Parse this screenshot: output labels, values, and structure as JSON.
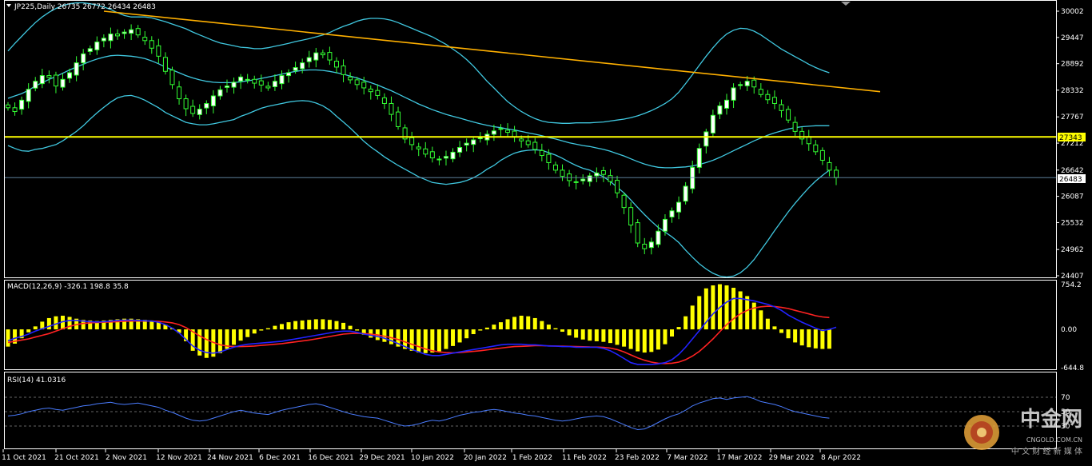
{
  "chart_data": [
    {
      "type": "candlestick",
      "title": "JP225,Daily 26735 26772 26434 26483",
      "x_labels": [
        "11 Oct 2021",
        "21 Oct 2021",
        "2 Nov 2021",
        "12 Nov 2021",
        "24 Nov 2021",
        "6 Dec 2021",
        "16 Dec 2021",
        "29 Dec 2021",
        "10 Jan 2022",
        "20 Jan 2022",
        "1 Feb 2022",
        "11 Feb 2022",
        "23 Feb 2022",
        "7 Mar 2022",
        "17 Mar 2022",
        "29 Mar 2022",
        "8 Apr 2022"
      ],
      "y_ticks": [
        "30002",
        "29447",
        "28892",
        "28332",
        "27767",
        "27212",
        "26642",
        "26087",
        "25532",
        "24962",
        "24407"
      ],
      "ylim": [
        24407,
        30002
      ],
      "price_labels": {
        "horizontal_level": "27343",
        "last_price": "26483"
      },
      "close_series": [
        27960,
        27880,
        28120,
        28350,
        28520,
        28640,
        28600,
        28420,
        28560,
        28700,
        28910,
        29100,
        29210,
        29350,
        29430,
        29520,
        29480,
        29560,
        29610,
        29500,
        29380,
        29220,
        29050,
        28730,
        28450,
        28150,
        27940,
        27840,
        27930,
        28050,
        28210,
        28340,
        28420,
        28500,
        28610,
        28560,
        28480,
        28440,
        28380,
        28520,
        28640,
        28700,
        28810,
        28910,
        29020,
        29120,
        29080,
        28970,
        28820,
        28660,
        28550,
        28450,
        28380,
        28300,
        28220,
        28050,
        27820,
        27560,
        27300,
        27180,
        27090,
        26980,
        26900,
        26870,
        26930,
        27020,
        27120,
        27210,
        27280,
        27330,
        27400,
        27470,
        27510,
        27440,
        27350,
        27260,
        27180,
        27080,
        26950,
        26800,
        26640,
        26510,
        26420,
        26390,
        26450,
        26520,
        26580,
        26550,
        26400,
        26160,
        25850,
        25480,
        25100,
        24980,
        25120,
        25350,
        25600,
        25780,
        25960,
        26300,
        26700,
        27100,
        27450,
        27800,
        28000,
        28120,
        28380,
        28450,
        28520,
        28400,
        28240,
        28130,
        28050,
        27900,
        27700,
        27460,
        27300,
        27200,
        27030,
        26850,
        26640,
        26483
      ],
      "bollinger_upper": [
        29160,
        29320,
        29470,
        29620,
        29760,
        29880,
        29980,
        30060,
        30120,
        30160,
        30180,
        30180,
        30160,
        30130,
        30090,
        30040,
        29970,
        29910,
        29880,
        29880,
        29880,
        29860,
        29820,
        29780,
        29730,
        29680,
        29630,
        29560,
        29500,
        29440,
        29380,
        29330,
        29300,
        29270,
        29240,
        29230,
        29210,
        29210,
        29230,
        29260,
        29290,
        29320,
        29360,
        29390,
        29420,
        29460,
        29500,
        29550,
        29620,
        29680,
        29730,
        29790,
        29830,
        29850,
        29850,
        29840,
        29810,
        29760,
        29700,
        29640,
        29580,
        29520,
        29460,
        29380,
        29300,
        29200,
        29100,
        28980,
        28840,
        28680,
        28520,
        28380,
        28230,
        28090,
        27980,
        27880,
        27800,
        27730,
        27680,
        27650,
        27640,
        27630,
        27630,
        27640,
        27640,
        27640,
        27650,
        27660,
        27680,
        27700,
        27720,
        27750,
        27790,
        27840,
        27900,
        27970,
        28050,
        28150,
        28290,
        28470,
        28660,
        28860,
        29050,
        29230,
        29390,
        29520,
        29600,
        29640,
        29630,
        29580,
        29500,
        29400,
        29300,
        29200,
        29120,
        29040,
        28960,
        28880,
        28810,
        28750,
        28700
      ],
      "bollinger_middle": [
        28160,
        28210,
        28260,
        28330,
        28420,
        28490,
        28560,
        28620,
        28690,
        28760,
        28820,
        28880,
        28940,
        28990,
        29030,
        29060,
        29070,
        29060,
        29050,
        29030,
        29000,
        28950,
        28890,
        28820,
        28760,
        28700,
        28640,
        28590,
        28550,
        28520,
        28500,
        28490,
        28490,
        28490,
        28510,
        28530,
        28550,
        28580,
        28610,
        28640,
        28670,
        28700,
        28730,
        28750,
        28760,
        28760,
        28750,
        28730,
        28700,
        28670,
        28630,
        28590,
        28540,
        28490,
        28440,
        28380,
        28320,
        28250,
        28180,
        28110,
        28040,
        27980,
        27920,
        27870,
        27820,
        27780,
        27740,
        27700,
        27660,
        27620,
        27590,
        27560,
        27540,
        27510,
        27490,
        27460,
        27430,
        27400,
        27370,
        27330,
        27300,
        27260,
        27220,
        27190,
        27160,
        27140,
        27110,
        27080,
        27040,
        26990,
        26940,
        26880,
        26820,
        26770,
        26730,
        26700,
        26690,
        26690,
        26700,
        26710,
        26730,
        26760,
        26800,
        26850,
        26910,
        26980,
        27050,
        27120,
        27190,
        27260,
        27320,
        27380,
        27430,
        27470,
        27510,
        27540,
        27560,
        27570,
        27580,
        27580,
        27580
      ],
      "bollinger_lower": [
        27160,
        27100,
        27050,
        27040,
        27080,
        27100,
        27140,
        27180,
        27260,
        27360,
        27460,
        27580,
        27720,
        27850,
        27970,
        28080,
        28170,
        28210,
        28220,
        28180,
        28120,
        28040,
        27960,
        27860,
        27790,
        27720,
        27650,
        27620,
        27600,
        27600,
        27620,
        27650,
        27680,
        27710,
        27780,
        27830,
        27890,
        27950,
        27990,
        28020,
        28050,
        28080,
        28100,
        28110,
        28100,
        28060,
        28000,
        27910,
        27780,
        27660,
        27530,
        27390,
        27250,
        27130,
        27030,
        26920,
        26830,
        26740,
        26660,
        26580,
        26500,
        26440,
        26380,
        26360,
        26340,
        26360,
        26380,
        26420,
        26480,
        26560,
        26660,
        26740,
        26850,
        26930,
        27000,
        27040,
        27060,
        27070,
        27060,
        27010,
        26960,
        26890,
        26810,
        26740,
        26680,
        26640,
        26570,
        26500,
        26400,
        26280,
        26160,
        26010,
        25850,
        25700,
        25560,
        25430,
        25330,
        25230,
        25110,
        24950,
        24800,
        24660,
        24550,
        24460,
        24400,
        24380,
        24400,
        24470,
        24590,
        24750,
        24950,
        25150,
        25360,
        25560,
        25760,
        25940,
        26110,
        26270,
        26410,
        26530,
        26640
      ],
      "trendline": {
        "from": [
          "11 Oct 2021",
          30002
        ],
        "to": [
          "8 Apr 2022",
          28300
        ]
      },
      "horizontal_level": 27343,
      "last_price": 26483,
      "colors": {
        "background": "#000000",
        "candle": "#33ff33",
        "bollinger": "#40c8e0",
        "trendline": "#ffb000",
        "level": "#ffff00"
      }
    },
    {
      "type": "histogram+line",
      "title": "MACD(12,26,9) -326.1 198.8 35.8",
      "y_ticks": [
        "754.2",
        "0.00",
        "-644.8"
      ],
      "ylim": [
        -644.8,
        754.2
      ],
      "histogram": [
        -290,
        -240,
        -150,
        -50,
        50,
        130,
        190,
        220,
        230,
        210,
        180,
        160,
        150,
        140,
        150,
        160,
        170,
        180,
        180,
        170,
        160,
        150,
        120,
        80,
        20,
        -60,
        -200,
        -360,
        -440,
        -480,
        -460,
        -400,
        -330,
        -260,
        -190,
        -130,
        -70,
        -20,
        20,
        60,
        90,
        120,
        140,
        150,
        160,
        170,
        170,
        160,
        140,
        110,
        60,
        -20,
        -90,
        -140,
        -180,
        -210,
        -250,
        -290,
        -330,
        -360,
        -390,
        -400,
        -390,
        -370,
        -330,
        -280,
        -220,
        -150,
        -80,
        -20,
        30,
        80,
        120,
        170,
        210,
        230,
        220,
        190,
        140,
        80,
        20,
        -40,
        -100,
        -140,
        -170,
        -190,
        -200,
        -210,
        -230,
        -260,
        -290,
        -330,
        -370,
        -390,
        -380,
        -340,
        -250,
        -120,
        40,
        220,
        400,
        560,
        690,
        740,
        760,
        740,
        700,
        640,
        560,
        450,
        320,
        180,
        50,
        -60,
        -150,
        -220,
        -270,
        -300,
        -320,
        -330,
        -326
      ],
      "macd_line": [
        -190,
        -150,
        -120,
        -80,
        -30,
        10,
        50,
        90,
        130,
        150,
        150,
        140,
        130,
        125,
        130,
        140,
        150,
        155,
        155,
        150,
        145,
        140,
        120,
        80,
        20,
        -60,
        -170,
        -280,
        -350,
        -390,
        -400,
        -380,
        -340,
        -300,
        -270,
        -250,
        -240,
        -230,
        -220,
        -210,
        -200,
        -180,
        -160,
        -140,
        -120,
        -100,
        -80,
        -60,
        -40,
        -30,
        -30,
        -50,
        -80,
        -100,
        -120,
        -150,
        -190,
        -240,
        -290,
        -340,
        -380,
        -420,
        -440,
        -440,
        -420,
        -400,
        -380,
        -360,
        -340,
        -320,
        -300,
        -280,
        -260,
        -250,
        -250,
        -250,
        -260,
        -260,
        -270,
        -280,
        -280,
        -290,
        -290,
        -300,
        -300,
        -300,
        -300,
        -320,
        -360,
        -420,
        -490,
        -560,
        -590,
        -590,
        -590,
        -580,
        -560,
        -510,
        -420,
        -300,
        -160,
        -20,
        120,
        260,
        370,
        460,
        520,
        520,
        500,
        480,
        450,
        420,
        380,
        320,
        240,
        180,
        120,
        70,
        20,
        -20,
        0,
        36
      ],
      "signal_line": [
        -220,
        -200,
        -180,
        -160,
        -130,
        -100,
        -70,
        -30,
        10,
        50,
        80,
        100,
        110,
        115,
        120,
        125,
        130,
        135,
        140,
        140,
        140,
        140,
        135,
        125,
        110,
        80,
        30,
        -40,
        -110,
        -170,
        -220,
        -260,
        -280,
        -290,
        -290,
        -285,
        -280,
        -270,
        -260,
        -250,
        -240,
        -225,
        -210,
        -195,
        -180,
        -160,
        -140,
        -120,
        -100,
        -80,
        -70,
        -65,
        -70,
        -80,
        -95,
        -115,
        -140,
        -170,
        -210,
        -250,
        -290,
        -330,
        -360,
        -380,
        -390,
        -395,
        -390,
        -380,
        -370,
        -360,
        -345,
        -330,
        -315,
        -300,
        -290,
        -285,
        -280,
        -275,
        -275,
        -278,
        -280,
        -283,
        -286,
        -290,
        -293,
        -296,
        -298,
        -302,
        -315,
        -340,
        -380,
        -430,
        -480,
        -520,
        -550,
        -570,
        -575,
        -570,
        -550,
        -510,
        -450,
        -370,
        -270,
        -160,
        -40,
        80,
        180,
        260,
        320,
        360,
        380,
        390,
        385,
        370,
        350,
        320,
        290,
        260,
        230,
        210,
        199
      ],
      "colors": {
        "histogram": "#ffff00",
        "macd": "#2222ff",
        "signal": "#ff2222"
      }
    },
    {
      "type": "line",
      "title": "RSI(14) 41.0316",
      "y_ticks": [
        "70",
        "50",
        "30"
      ],
      "ylim": [
        0,
        100
      ],
      "levels": [
        70,
        50,
        30
      ],
      "values": [
        44,
        45,
        47,
        50,
        52,
        54,
        55,
        53,
        52,
        54,
        56,
        58,
        59,
        61,
        62,
        63,
        61,
        60,
        61,
        62,
        60,
        58,
        56,
        52,
        49,
        45,
        41,
        38,
        37,
        38,
        41,
        44,
        47,
        50,
        52,
        50,
        48,
        47,
        46,
        49,
        52,
        54,
        56,
        58,
        60,
        61,
        59,
        56,
        53,
        50,
        47,
        45,
        43,
        42,
        41,
        38,
        35,
        32,
        30,
        31,
        33,
        36,
        38,
        37,
        39,
        42,
        45,
        47,
        49,
        50,
        52,
        53,
        52,
        50,
        48,
        47,
        45,
        44,
        42,
        40,
        38,
        37,
        38,
        40,
        42,
        43,
        44,
        43,
        40,
        36,
        32,
        28,
        25,
        26,
        30,
        35,
        40,
        44,
        47,
        52,
        58,
        62,
        65,
        68,
        69,
        67,
        69,
        70,
        71,
        68,
        64,
        62,
        60,
        57,
        53,
        50,
        48,
        46,
        44,
        42,
        41
      ],
      "colors": {
        "line": "#4a7cff",
        "levels": "#888888"
      }
    }
  ],
  "watermark": {
    "brand": "中金网",
    "domain": "CNGOLD.COM.CN",
    "tagline": "中 文 财 经 新 媒 体"
  }
}
